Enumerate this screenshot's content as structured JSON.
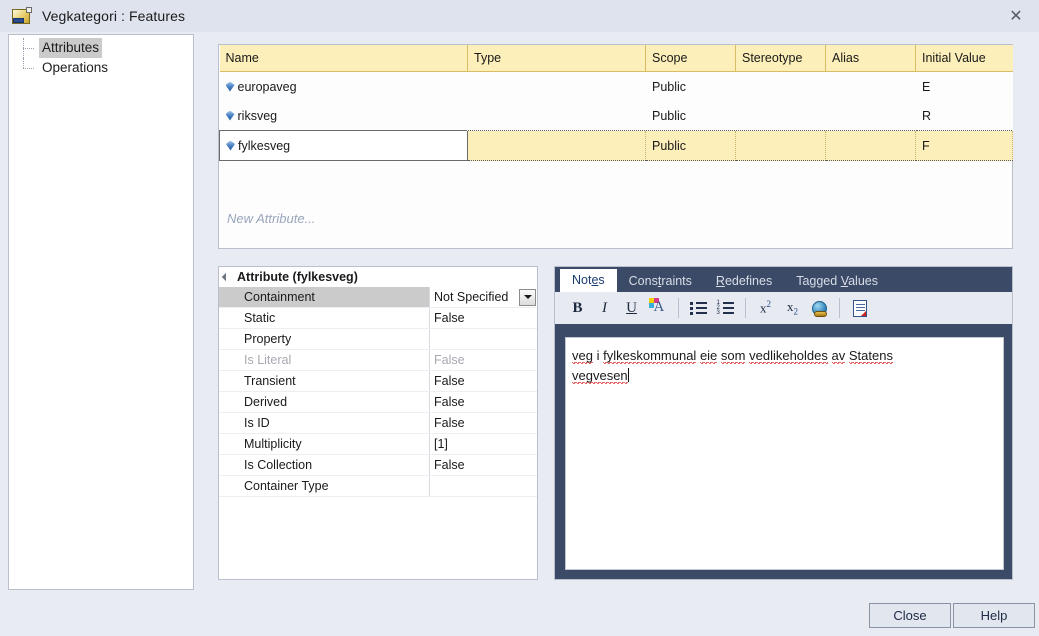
{
  "window": {
    "title": "Vegkategori : Features",
    "icon": "class-feature-icon",
    "close_label": "✕"
  },
  "tree": {
    "items": [
      {
        "label": "Attributes",
        "selected": true
      },
      {
        "label": "Operations",
        "selected": false
      }
    ]
  },
  "attributes_table": {
    "columns": [
      "Name",
      "Type",
      "Scope",
      "Stereotype",
      "Alias",
      "Initial Value"
    ],
    "rows": [
      {
        "name": "europaveg",
        "type": "",
        "scope": "Public",
        "stereotype": "",
        "alias": "",
        "initial_value": "E",
        "selected": false
      },
      {
        "name": "riksveg",
        "type": "",
        "scope": "Public",
        "stereotype": "",
        "alias": "",
        "initial_value": "R",
        "selected": false
      },
      {
        "name": "fylkesveg",
        "type": "",
        "scope": "Public",
        "stereotype": "",
        "alias": "",
        "initial_value": "F",
        "selected": true
      }
    ],
    "new_row_label": "New Attribute..."
  },
  "property_grid": {
    "header": "Attribute (fylkesveg)",
    "rows": [
      {
        "name": "Containment",
        "value": "Not Specified",
        "selected": true,
        "dim": false,
        "editor": "dropdown"
      },
      {
        "name": "Static",
        "value": "False",
        "selected": false,
        "dim": false
      },
      {
        "name": "Property",
        "value": "",
        "selected": false,
        "dim": false
      },
      {
        "name": "Is Literal",
        "value": "False",
        "selected": false,
        "dim": true
      },
      {
        "name": "Transient",
        "value": "False",
        "selected": false,
        "dim": false
      },
      {
        "name": "Derived",
        "value": "False",
        "selected": false,
        "dim": false
      },
      {
        "name": "Is ID",
        "value": "False",
        "selected": false,
        "dim": false
      },
      {
        "name": "Multiplicity",
        "value": "[1]",
        "selected": false,
        "dim": false
      },
      {
        "name": "Is Collection",
        "value": "False",
        "selected": false,
        "dim": false
      },
      {
        "name": "Container Type",
        "value": "",
        "selected": false,
        "dim": false
      }
    ]
  },
  "notes_panel": {
    "tabs": [
      {
        "pre": "Not",
        "key": "e",
        "post": "s",
        "active": true
      },
      {
        "pre": "Cons",
        "key": "t",
        "post": "raints",
        "active": false
      },
      {
        "pre": "",
        "key": "R",
        "post": "edefines",
        "active": false
      },
      {
        "pre": "Tagged ",
        "key": "V",
        "post": "alues",
        "active": false
      }
    ],
    "toolbar": [
      {
        "icon": "bold-icon",
        "label": "B"
      },
      {
        "icon": "italic-icon",
        "label": "I"
      },
      {
        "icon": "underline-icon",
        "label": "U"
      },
      {
        "icon": "font-color-icon",
        "label": "A"
      },
      {
        "icon": "bullet-list-icon",
        "label": ""
      },
      {
        "icon": "numbered-list-icon",
        "label": ""
      },
      {
        "icon": "superscript-icon",
        "label": "x2"
      },
      {
        "icon": "subscript-icon",
        "label": "x2"
      },
      {
        "icon": "hyperlink-icon",
        "label": ""
      },
      {
        "icon": "insert-document-icon",
        "label": ""
      }
    ],
    "note_text_line1": "veg i fylkeskommunal eie som vedlikeholdes av Statens",
    "note_text_line2": "vegvesen",
    "note_words_line1": [
      "veg",
      "i",
      "fylkeskommunal",
      "eie",
      "som",
      "vedlikeholdes",
      "av",
      "Statens"
    ],
    "note_words_line2": [
      "vegvesen"
    ]
  },
  "footer": {
    "close_label": "Close",
    "help_label": "Help"
  },
  "colors": {
    "window_bg": "#e8ebf2",
    "titlebar_bg": "#dfe3ee",
    "table_header_bg": "#fcefb9",
    "selected_row_bg": "#fcefb9",
    "tabstrip_bg": "#3b4a66",
    "tree_selection": "#cbcbcb",
    "new_attribute_text": "#9aa6bd"
  }
}
